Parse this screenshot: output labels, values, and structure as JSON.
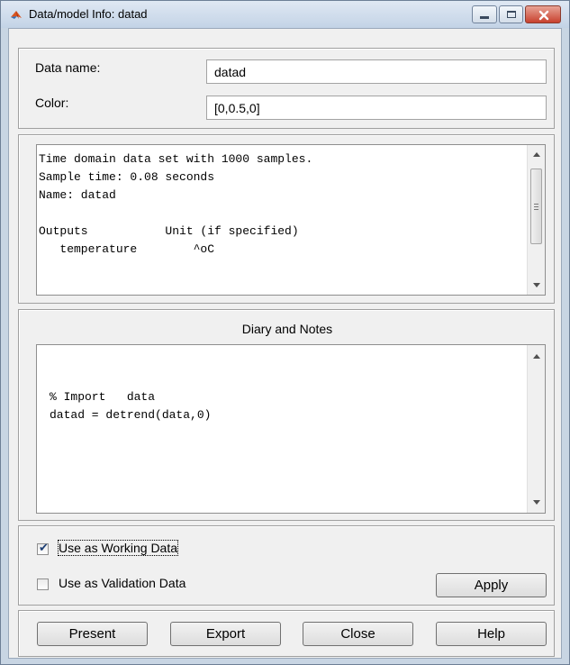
{
  "window": {
    "title": "Data/model Info: datad"
  },
  "info": {
    "data_name_label": "Data name:",
    "data_name_value": "datad",
    "color_label": "Color:",
    "color_value": "[0,0.5,0]"
  },
  "description": {
    "lines": [
      "Time domain data set with 1000 samples.",
      "Sample time: 0.08 seconds",
      "Name: datad",
      "",
      "Outputs           Unit (if specified)",
      "   temperature        ^oC"
    ]
  },
  "notes": {
    "title": "Diary and Notes",
    "lines": [
      "% Import   data",
      "datad = detrend(data,0)"
    ]
  },
  "options": {
    "working_label": "Use as Working Data",
    "working_checked": true,
    "validation_label": "Use as Validation Data",
    "validation_checked": false,
    "apply_label": "Apply"
  },
  "buttons": {
    "present": "Present",
    "export": "Export",
    "close": "Close",
    "help": "Help"
  },
  "icons": {
    "app": "matlab-icon",
    "minimize": "minimize-icon",
    "maximize": "maximize-icon",
    "close": "close-icon",
    "check": "checkmark-icon"
  }
}
